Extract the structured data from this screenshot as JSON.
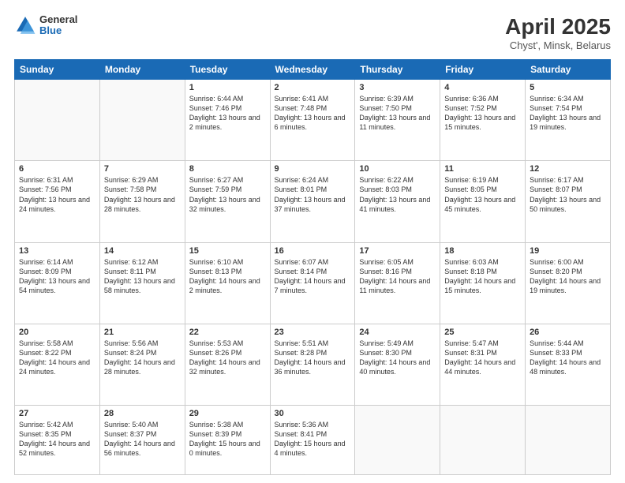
{
  "header": {
    "logo": {
      "line1": "General",
      "line2": "Blue"
    },
    "title": "April 2025",
    "subtitle": "Chyst', Minsk, Belarus"
  },
  "weekdays": [
    "Sunday",
    "Monday",
    "Tuesday",
    "Wednesday",
    "Thursday",
    "Friday",
    "Saturday"
  ],
  "weeks": [
    [
      {
        "day": "",
        "info": ""
      },
      {
        "day": "",
        "info": ""
      },
      {
        "day": "1",
        "info": "Sunrise: 6:44 AM\nSunset: 7:46 PM\nDaylight: 13 hours and 2 minutes."
      },
      {
        "day": "2",
        "info": "Sunrise: 6:41 AM\nSunset: 7:48 PM\nDaylight: 13 hours and 6 minutes."
      },
      {
        "day": "3",
        "info": "Sunrise: 6:39 AM\nSunset: 7:50 PM\nDaylight: 13 hours and 11 minutes."
      },
      {
        "day": "4",
        "info": "Sunrise: 6:36 AM\nSunset: 7:52 PM\nDaylight: 13 hours and 15 minutes."
      },
      {
        "day": "5",
        "info": "Sunrise: 6:34 AM\nSunset: 7:54 PM\nDaylight: 13 hours and 19 minutes."
      }
    ],
    [
      {
        "day": "6",
        "info": "Sunrise: 6:31 AM\nSunset: 7:56 PM\nDaylight: 13 hours and 24 minutes."
      },
      {
        "day": "7",
        "info": "Sunrise: 6:29 AM\nSunset: 7:58 PM\nDaylight: 13 hours and 28 minutes."
      },
      {
        "day": "8",
        "info": "Sunrise: 6:27 AM\nSunset: 7:59 PM\nDaylight: 13 hours and 32 minutes."
      },
      {
        "day": "9",
        "info": "Sunrise: 6:24 AM\nSunset: 8:01 PM\nDaylight: 13 hours and 37 minutes."
      },
      {
        "day": "10",
        "info": "Sunrise: 6:22 AM\nSunset: 8:03 PM\nDaylight: 13 hours and 41 minutes."
      },
      {
        "day": "11",
        "info": "Sunrise: 6:19 AM\nSunset: 8:05 PM\nDaylight: 13 hours and 45 minutes."
      },
      {
        "day": "12",
        "info": "Sunrise: 6:17 AM\nSunset: 8:07 PM\nDaylight: 13 hours and 50 minutes."
      }
    ],
    [
      {
        "day": "13",
        "info": "Sunrise: 6:14 AM\nSunset: 8:09 PM\nDaylight: 13 hours and 54 minutes."
      },
      {
        "day": "14",
        "info": "Sunrise: 6:12 AM\nSunset: 8:11 PM\nDaylight: 13 hours and 58 minutes."
      },
      {
        "day": "15",
        "info": "Sunrise: 6:10 AM\nSunset: 8:13 PM\nDaylight: 14 hours and 2 minutes."
      },
      {
        "day": "16",
        "info": "Sunrise: 6:07 AM\nSunset: 8:14 PM\nDaylight: 14 hours and 7 minutes."
      },
      {
        "day": "17",
        "info": "Sunrise: 6:05 AM\nSunset: 8:16 PM\nDaylight: 14 hours and 11 minutes."
      },
      {
        "day": "18",
        "info": "Sunrise: 6:03 AM\nSunset: 8:18 PM\nDaylight: 14 hours and 15 minutes."
      },
      {
        "day": "19",
        "info": "Sunrise: 6:00 AM\nSunset: 8:20 PM\nDaylight: 14 hours and 19 minutes."
      }
    ],
    [
      {
        "day": "20",
        "info": "Sunrise: 5:58 AM\nSunset: 8:22 PM\nDaylight: 14 hours and 24 minutes."
      },
      {
        "day": "21",
        "info": "Sunrise: 5:56 AM\nSunset: 8:24 PM\nDaylight: 14 hours and 28 minutes."
      },
      {
        "day": "22",
        "info": "Sunrise: 5:53 AM\nSunset: 8:26 PM\nDaylight: 14 hours and 32 minutes."
      },
      {
        "day": "23",
        "info": "Sunrise: 5:51 AM\nSunset: 8:28 PM\nDaylight: 14 hours and 36 minutes."
      },
      {
        "day": "24",
        "info": "Sunrise: 5:49 AM\nSunset: 8:30 PM\nDaylight: 14 hours and 40 minutes."
      },
      {
        "day": "25",
        "info": "Sunrise: 5:47 AM\nSunset: 8:31 PM\nDaylight: 14 hours and 44 minutes."
      },
      {
        "day": "26",
        "info": "Sunrise: 5:44 AM\nSunset: 8:33 PM\nDaylight: 14 hours and 48 minutes."
      }
    ],
    [
      {
        "day": "27",
        "info": "Sunrise: 5:42 AM\nSunset: 8:35 PM\nDaylight: 14 hours and 52 minutes."
      },
      {
        "day": "28",
        "info": "Sunrise: 5:40 AM\nSunset: 8:37 PM\nDaylight: 14 hours and 56 minutes."
      },
      {
        "day": "29",
        "info": "Sunrise: 5:38 AM\nSunset: 8:39 PM\nDaylight: 15 hours and 0 minutes."
      },
      {
        "day": "30",
        "info": "Sunrise: 5:36 AM\nSunset: 8:41 PM\nDaylight: 15 hours and 4 minutes."
      },
      {
        "day": "",
        "info": ""
      },
      {
        "day": "",
        "info": ""
      },
      {
        "day": "",
        "info": ""
      }
    ]
  ]
}
